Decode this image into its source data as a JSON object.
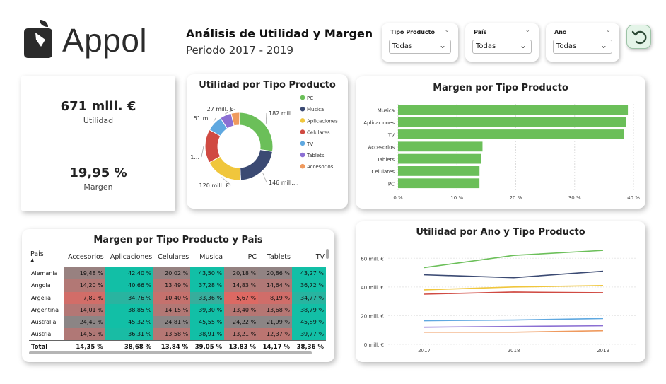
{
  "header": {
    "logo_text": "Appol",
    "title": "Análisis de Utilidad y Margen",
    "subtitle": "Periodo 2017 - 2019"
  },
  "filters": [
    {
      "label": "Tipo Producto",
      "value": "Todas"
    },
    {
      "label": "País",
      "value": "Todas"
    },
    {
      "label": "Año",
      "value": "Todas"
    }
  ],
  "kpis": {
    "utilidad_value": "671 mill. €",
    "utilidad_label": "Utilidad",
    "margen_value": "19,95 %",
    "margen_label": "Margen"
  },
  "colors": {
    "PC": "#6bbf59",
    "Musica": "#3b4a73",
    "Aplicaciones": "#f0c63c",
    "Celulares": "#d04a42",
    "TV": "#5fa8e0",
    "Tablets": "#8b6fd3",
    "Accesorios": "#ef9a5e",
    "bar": "#6bbf59",
    "heat_low": "#e06862",
    "heat_mid": "#8b8585",
    "heat_high": "#12bfa6"
  },
  "chart_data": [
    {
      "type": "pie",
      "title": "Utilidad por Tipo Producto",
      "legend": [
        "PC",
        "Musica",
        "Aplicaciones",
        "Celulares",
        "TV",
        "Tablets",
        "Accesorios"
      ],
      "categories": [
        "PC",
        "Musica",
        "Aplicaciones",
        "Celulares",
        "TV",
        "Tablets",
        "Accesorios"
      ],
      "values": [
        182,
        146,
        120,
        108,
        51,
        37,
        27
      ],
      "data_labels": [
        "182 mill....",
        "146 mill....",
        "120 mill. €",
        "1...",
        "51 m...",
        "27 mill. €",
        ""
      ]
    },
    {
      "type": "bar",
      "title": "Margen por Tipo Producto",
      "categories": [
        "Musica",
        "Aplicaciones",
        "TV",
        "Accesorios",
        "Tablets",
        "Celulares",
        "PC"
      ],
      "values": [
        39.05,
        38.68,
        38.36,
        14.35,
        14.17,
        13.84,
        13.83
      ],
      "xlim": [
        0,
        40
      ],
      "ticks": [
        "0 %",
        "10 %",
        "20 %",
        "30 %",
        "40 %"
      ]
    },
    {
      "type": "table",
      "title": "Margen por Tipo Producto y Pais",
      "columns": [
        "Pais",
        "Accesorios",
        "Aplicaciones",
        "Celulares",
        "Musica",
        "PC",
        "Tablets",
        "TV"
      ],
      "rows": [
        {
          "country": "Alemania",
          "values": [
            "19,48 %",
            "42,40 %",
            "20,02 %",
            "43,50 %",
            "20,18 %",
            "20,86 %",
            "43,27 %"
          ],
          "nums": [
            19.48,
            42.4,
            20.02,
            43.5,
            20.18,
            20.86,
            43.27
          ]
        },
        {
          "country": "Angola",
          "values": [
            "14,20 %",
            "40,66 %",
            "13,49 %",
            "37,28 %",
            "14,83 %",
            "14,64 %",
            "36,72 %"
          ],
          "nums": [
            14.2,
            40.66,
            13.49,
            37.28,
            14.83,
            14.64,
            36.72
          ]
        },
        {
          "country": "Argelia",
          "values": [
            "7,89 %",
            "34,76 %",
            "10,40 %",
            "33,36 %",
            "5,67 %",
            "8,19 %",
            "34,77 %"
          ],
          "nums": [
            7.89,
            34.76,
            10.4,
            33.36,
            5.67,
            8.19,
            34.77
          ]
        },
        {
          "country": "Argentina",
          "values": [
            "14,01 %",
            "38,85 %",
            "14,15 %",
            "39,30 %",
            "13,40 %",
            "13,68 %",
            "38,79 %"
          ],
          "nums": [
            14.01,
            38.85,
            14.15,
            39.3,
            13.4,
            13.68,
            38.79
          ]
        },
        {
          "country": "Australia",
          "values": [
            "24,49 %",
            "45,32 %",
            "24,81 %",
            "45,55 %",
            "24,22 %",
            "21,99 %",
            "45,89 %"
          ],
          "nums": [
            24.49,
            45.32,
            24.81,
            45.55,
            24.22,
            21.99,
            45.89
          ]
        },
        {
          "country": "Austria",
          "values": [
            "14,59 %",
            "36,31 %",
            "13,58 %",
            "38,91 %",
            "13,21 %",
            "12,37 %",
            "39,77 %"
          ],
          "nums": [
            14.59,
            36.31,
            13.58,
            38.91,
            13.21,
            12.37,
            39.77
          ]
        }
      ],
      "total": {
        "country": "Total",
        "values": [
          "14,35 %",
          "38,68 %",
          "13,84 %",
          "39,05 %",
          "13,83 %",
          "14,17 %",
          "38,36 %"
        ]
      }
    },
    {
      "type": "line",
      "title": "Utilidad por Año y Tipo Producto",
      "x": [
        "2017",
        "2018",
        "2019"
      ],
      "ylim": [
        0,
        70
      ],
      "yticks": [
        "0 mill. €",
        "20 mill. €",
        "40 mill. €",
        "60 mill. €"
      ],
      "series": [
        {
          "name": "PC",
          "values": [
            53.5,
            62,
            65.5
          ]
        },
        {
          "name": "Musica",
          "values": [
            48.5,
            46.5,
            51
          ]
        },
        {
          "name": "Aplicaciones",
          "values": [
            38,
            40,
            41
          ]
        },
        {
          "name": "Celulares",
          "values": [
            35,
            36.5,
            36
          ]
        },
        {
          "name": "TV",
          "values": [
            16.5,
            17,
            18
          ]
        },
        {
          "name": "Tablets",
          "values": [
            12,
            12.5,
            13
          ]
        },
        {
          "name": "Accesorios",
          "values": [
            8.5,
            8.5,
            9.5
          ]
        }
      ]
    }
  ]
}
